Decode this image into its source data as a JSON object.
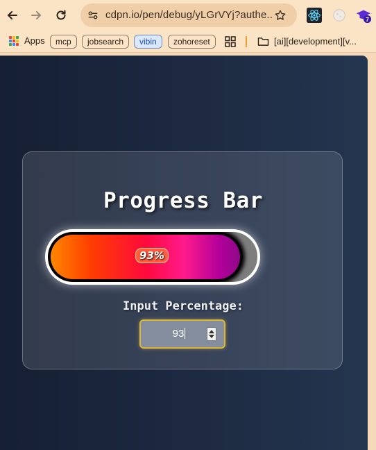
{
  "browser": {
    "url": "cdpn.io/pen/debug/yLGrVYj?authe...",
    "extension_badge": "7"
  },
  "bookmarks": {
    "apps_label": "Apps",
    "items": [
      "mcp",
      "jobsearch",
      "vibin",
      "zohoreset"
    ],
    "folder_label": "[ai][development][v..."
  },
  "page": {
    "title": "Progress Bar",
    "progress_percent": 93,
    "progress_label": "93%",
    "input_label": "Input Percentage:",
    "input_value": "93"
  },
  "colors": {
    "fill_gradient": [
      "#ff8c00",
      "#ff3d00",
      "#ff0a3c",
      "#ff1a8c",
      "#b3009a",
      "#8a0a86"
    ],
    "input_border": "#e0b830",
    "active_bookmark": "#1a4fb5"
  }
}
